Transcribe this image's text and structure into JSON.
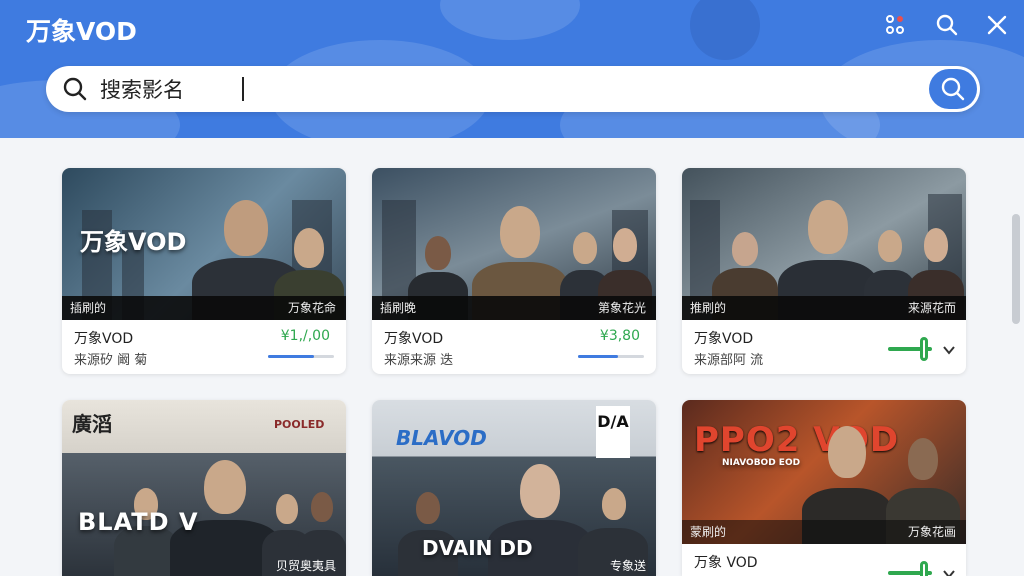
{
  "app": {
    "title": "万象VOD"
  },
  "header_icons": [
    "palette-icon",
    "search-icon",
    "close-icon"
  ],
  "search": {
    "value": "搜索影名",
    "placeholder": "搜索影名"
  },
  "cards": [
    {
      "title": "万象VOD",
      "source": "来源矽 阚 菊",
      "price": "¥1,/,00",
      "progress": 0.7,
      "poster_logo": "万象VOD",
      "tag_left": "插刷的",
      "tag_right": "万象花命"
    },
    {
      "title": "万象VOD",
      "source": "来源来源 迭",
      "price": "¥3,80",
      "progress": 0.6,
      "poster_logo": "",
      "tag_left": "插刷晚",
      "tag_right": "第象花光"
    },
    {
      "title": "万象VOD",
      "source": "来源部阿 流",
      "price": "",
      "progress": null,
      "poster_logo": "",
      "tag_left": "推刷的",
      "tag_right": "来源花而"
    },
    {
      "title": "",
      "source": "",
      "price": "",
      "progress": null,
      "poster_logo": "BLATD V",
      "poster_heading": "廣滔",
      "poster_corner": "POOLED",
      "tag_left": "",
      "tag_right": "贝贸奥夷具"
    },
    {
      "title": "",
      "source": "",
      "price": "",
      "progress": null,
      "poster_logo": "DVAIN DD",
      "poster_heading": "BLAVOD",
      "poster_corner": "D/A",
      "tag_left": "",
      "tag_right": "专象送"
    },
    {
      "title": "万象 VOD",
      "source": "",
      "price": "",
      "progress": null,
      "poster_logo": "PPO2 VOD",
      "poster_heading": "NIAVOBOD EOD",
      "tag_left": "蒙刷的",
      "tag_right": "万象花画"
    }
  ],
  "colors": {
    "accent": "#3f7be0",
    "green": "#2fa84f",
    "background": "#f3f5f8"
  }
}
